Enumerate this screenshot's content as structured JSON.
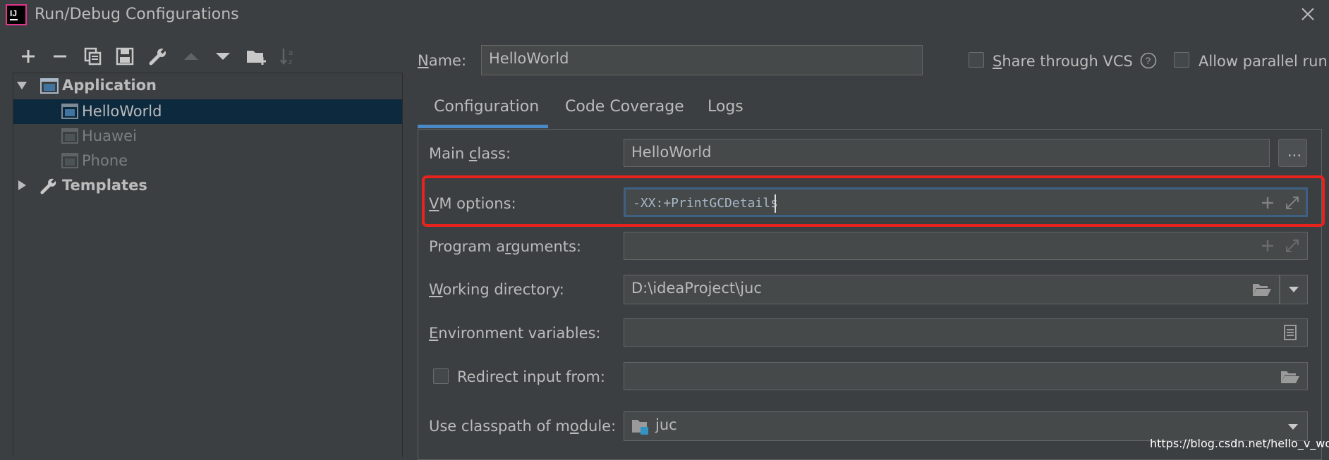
{
  "window": {
    "title": "Run/Debug Configurations"
  },
  "toolbar": {
    "icons": [
      "add-icon",
      "remove-icon",
      "copy-icon",
      "save-icon",
      "wrench-icon",
      "move-up-icon",
      "move-down-icon",
      "new-folder-icon",
      "sort-icon"
    ]
  },
  "tree": {
    "application": "Application",
    "items": [
      {
        "label": "HelloWorld",
        "selected": true
      },
      {
        "label": "Huawei"
      },
      {
        "label": "Phone"
      }
    ],
    "templates": "Templates"
  },
  "name_field": {
    "label_prefix": "",
    "label_mnemonic": "N",
    "label_rest": "ame:",
    "value": "HelloWorld"
  },
  "share_vcs": {
    "mnemonic": "S",
    "rest": "hare through VCS",
    "checked": false
  },
  "allow_parallel": {
    "label": "Allow parallel run",
    "checked": false
  },
  "tabs": [
    {
      "label": "Configuration",
      "active": true
    },
    {
      "label": "Code Coverage"
    },
    {
      "label": "Logs"
    }
  ],
  "form": {
    "main_class": {
      "pre": "Main ",
      "mn": "c",
      "post": "lass:",
      "value": "HelloWorld",
      "button": "..."
    },
    "vm_options": {
      "pre": "",
      "mn": "V",
      "post": "M options:",
      "value": "-XX:+PrintGCDetails"
    },
    "program_arguments": {
      "pre": "Program a",
      "mn": "r",
      "post": "guments:",
      "value": ""
    },
    "working_directory": {
      "pre": "",
      "mn": "W",
      "post": "orking directory:",
      "value": "D:\\ideaProject\\juc"
    },
    "environment_variables": {
      "pre": "",
      "mn": "E",
      "post": "nvironment variables:",
      "value": ""
    },
    "redirect_input": {
      "label": "Redirect input from:",
      "checked": false,
      "value": ""
    },
    "classpath_module": {
      "pre": "Use classpath of m",
      "mn": "o",
      "post": "dule:",
      "value": "juc"
    }
  },
  "watermark": "https://blog.csdn.net/hello_v_world",
  "colors": {
    "accent": "#4a88c7",
    "highlight": "#e6231d",
    "selection": "#0d293e"
  }
}
